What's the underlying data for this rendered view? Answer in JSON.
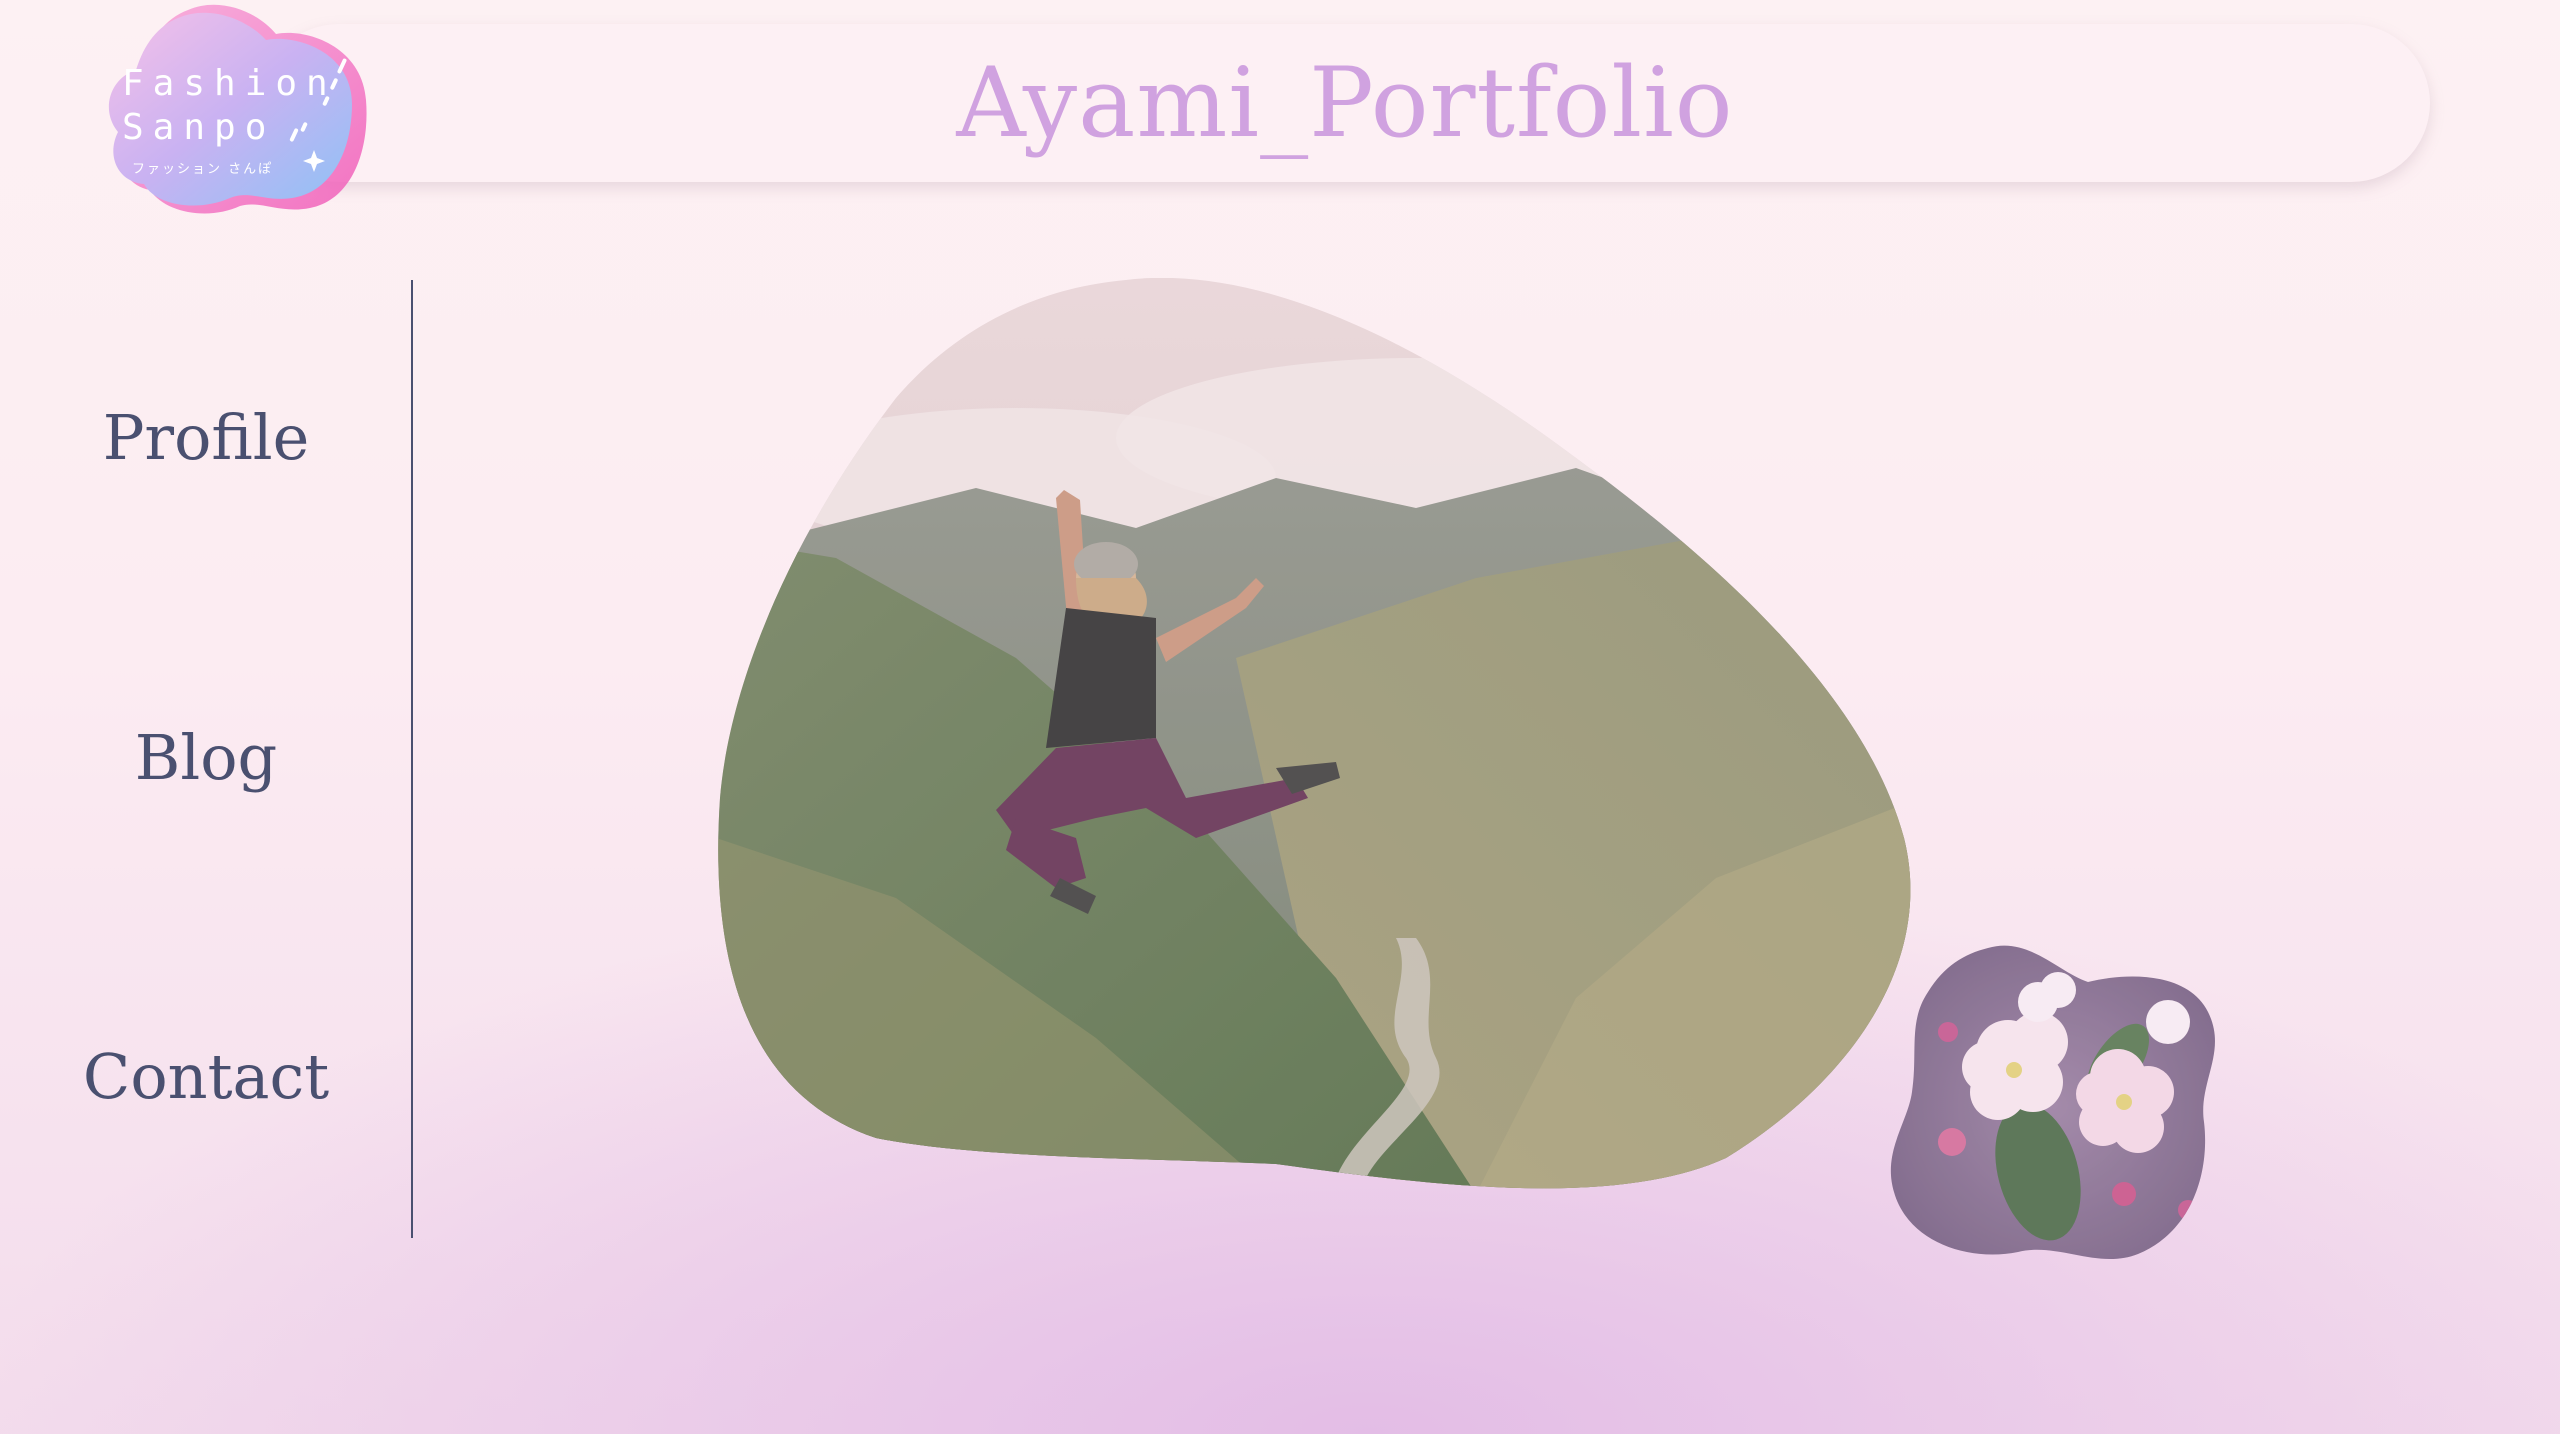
{
  "header": {
    "title": "Ayami_Portfolio"
  },
  "logo": {
    "line1": "Fashion",
    "line2": "Sanpo",
    "subtitle": "ファッション さんぽ"
  },
  "sidebar": {
    "items": [
      {
        "label": "Profile"
      },
      {
        "label": "Blog"
      },
      {
        "label": "Contact"
      }
    ]
  },
  "images": {
    "hero": "mountain-valley-jumping-woman-photo",
    "accent": "apple-blossom-flowers-photo"
  },
  "colors": {
    "title": "#d0a2e0",
    "nav_text": "#4a5070",
    "header_bg": "#fdf0f4",
    "page_bg": "#fcecf2",
    "glow": "#e3bde6"
  }
}
